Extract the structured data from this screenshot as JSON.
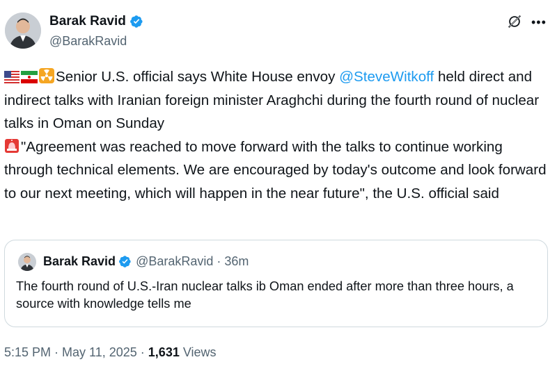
{
  "author": {
    "name": "Barak Ravid",
    "handle": "@BarakRavid"
  },
  "tweet": {
    "line1_pre": "Senior U.S. official says White House envoy ",
    "mention": "@SteveWitkoff",
    "line1_post": " held direct and indirect talks with Iranian foreign minister Araghchi during the fourth round of nuclear talks in Oman on Sunday",
    "para2": "\"Agreement was reached to move forward with the talks to continue working through technical elements. We are encouraged by today's outcome and look forward to our next meeting, which will happen in the near future\", the U.S. official said",
    "icons": [
      "us-flag-icon",
      "iran-flag-icon",
      "radioactive-icon",
      "siren-icon"
    ]
  },
  "quote": {
    "name": "Barak Ravid",
    "handle": "@BarakRavid",
    "separator": " · ",
    "time": "36m",
    "text": "The fourth round of U.S.-Iran nuclear talks ib Oman ended after more than three hours, a source with knowledge tells me"
  },
  "meta": {
    "time": "5:15 PM",
    "sep1": " · ",
    "date": "May 11, 2025",
    "sep2": " · ",
    "views_count": "1,631",
    "views_label": " Views"
  },
  "colors": {
    "text": "#0f1419",
    "secondary": "#536471",
    "link": "#1d9bf0",
    "border": "#cfd9de"
  }
}
